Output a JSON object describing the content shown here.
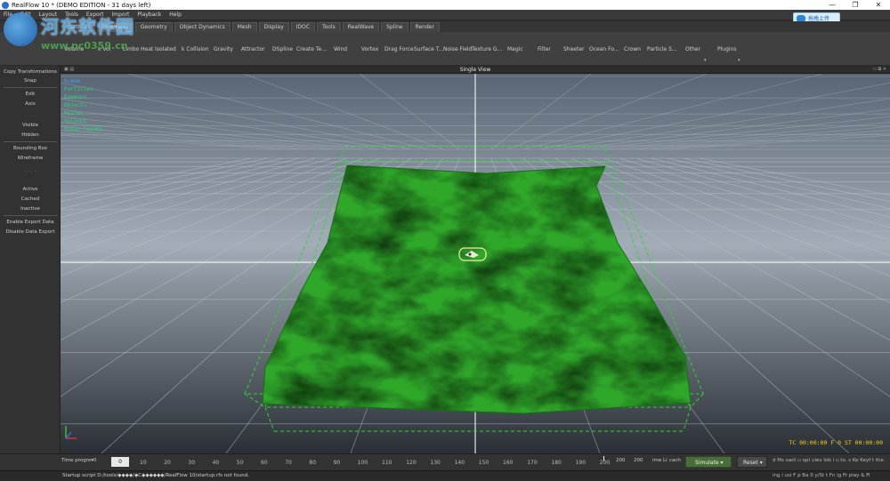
{
  "window": {
    "title": "RealFlow 10 * (DEMO EDITION - 31 days left)",
    "buttons": [
      "—",
      "❐",
      "✕"
    ]
  },
  "menu": [
    "File",
    "Edit",
    "Layout",
    "Tools",
    "Export",
    "Import",
    "Playback",
    "Help"
  ],
  "upload_button": "拖拽上传",
  "tabs": [
    {
      "label": "Particles",
      "active": false
    },
    {
      "label": "Daemons",
      "active": true
    },
    {
      "label": "Geometry",
      "active": false
    },
    {
      "label": "Object Dynamics",
      "active": false
    },
    {
      "label": "Mesh",
      "active": false
    },
    {
      "label": "Display",
      "active": false
    },
    {
      "label": "IDOC",
      "active": false
    },
    {
      "label": "Tools",
      "active": false
    },
    {
      "label": "RealWave",
      "active": false
    },
    {
      "label": "Spline",
      "active": false
    },
    {
      "label": "Render",
      "active": false
    }
  ],
  "toolbar": [
    "Volume",
    "k Vol",
    "Limbo",
    "Heat",
    "Isolated",
    "k Collision",
    "Gravity",
    "Attractor",
    "DSpline",
    "Create Te...",
    "Wind",
    "Vortex",
    "Drag Force",
    "Surface T...",
    "Noise Field",
    "Texture G...",
    "Magic",
    "Filter",
    "Sheeter",
    "Ocean Fo...",
    "Crown",
    "Particle S...",
    "Other",
    "Plugins"
  ],
  "left_panel": {
    "items": [
      "Copy Transformations",
      "Snap",
      "Edit",
      "Axis",
      "Visible",
      "Hidden",
      "Bounding Box",
      "Wireframe",
      "Active",
      "Cached",
      "Inactive",
      "Enable Export Data",
      "Disable Data Export"
    ],
    "dots": "· · · ·"
  },
  "viewport": {
    "title": "Single View",
    "overlay": [
      "Scene",
      "Particles",
      "Daemons",
      "Objects",
      "Meshes",
      "Splines",
      "Ocean_Foam01"
    ],
    "timecode": "TC 00:00:00   F 0   ST 00:00:00",
    "surface_color": "#2fa82a",
    "grid_color": "#8a96a4"
  },
  "timeline": {
    "mode_label": "Time progre▾",
    "start": "0",
    "current_frame": "0",
    "ticks": [
      "10",
      "20",
      "30",
      "40",
      "50",
      "60",
      "70",
      "80",
      "90",
      "100",
      "110",
      "120",
      "130",
      "140",
      "150",
      "160",
      "170",
      "180",
      "190",
      "200"
    ],
    "end_a": "200",
    "end_b": "200",
    "extra_a": "ime Li",
    "extra_b": "cach",
    "simulate": "Simulate",
    "reset": "Reset",
    "right_text": "d Ms  xact ▫ opl  ▫lev  lob i ▫ to.      s Ke  Keyf  t the"
  },
  "status": {
    "message": "Startup script D:/tools/◆◆◆◆/◆C◆◆◆◆◆◆/RealFlow 10/startup.rfs not found.",
    "right_text": "ing i  usi F  p Ba  0          y/St  t Fn  ig Fr  play  & Fi"
  },
  "watermark": {
    "title": "河东软件园",
    "url": "www.pc0359.cn"
  }
}
